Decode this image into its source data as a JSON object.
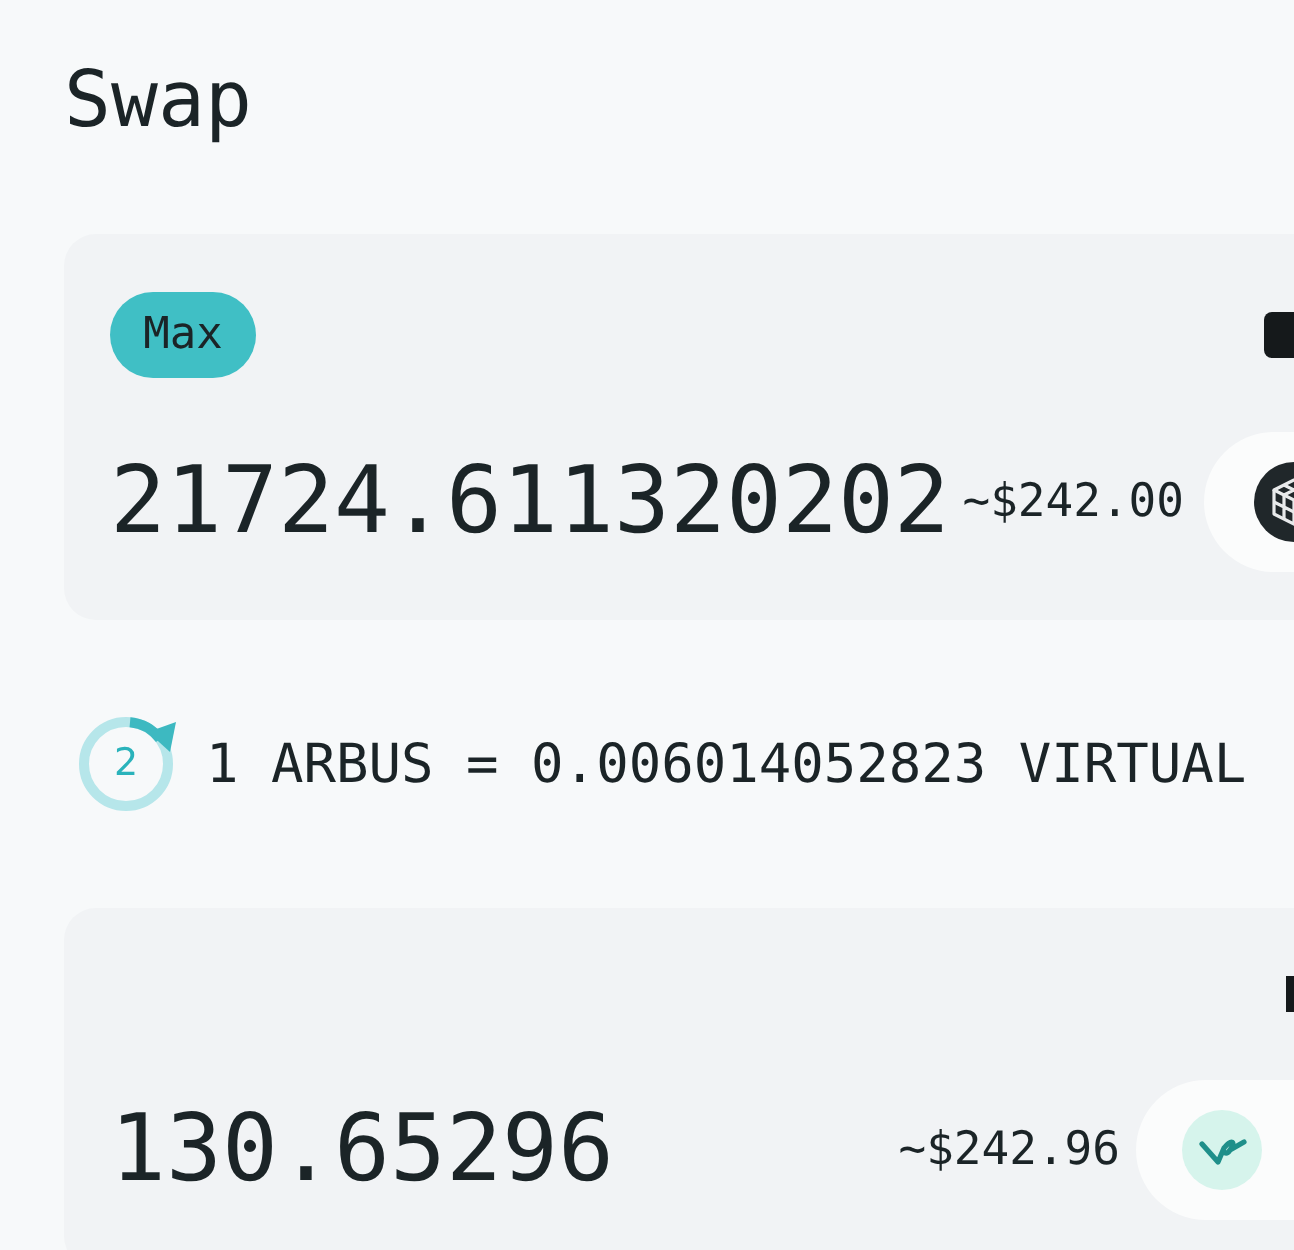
{
  "title": "Swap",
  "from_panel": {
    "max_button": "Max",
    "amount": "21724.611320202",
    "usd_value": "~$242.00"
  },
  "rate": {
    "refresh_countdown": "2",
    "text": "1 ARBUS = 0.006014052823 VIRTUAL"
  },
  "to_panel": {
    "amount": "130.65296",
    "usd_value": "~$242.96"
  }
}
